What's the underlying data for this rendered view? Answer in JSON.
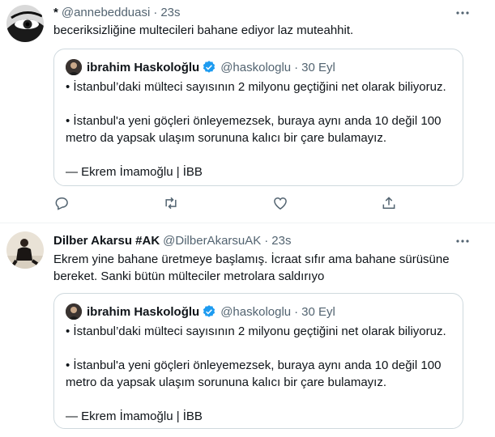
{
  "tweets": [
    {
      "name": "*",
      "handle": "@annebedduasi",
      "dot": "·",
      "time": "23s",
      "text": "beceriksizliğine multecileri bahane ediyor laz muteahhit.",
      "avatar_icon": "eye-avatar-icon",
      "quote": {
        "name": "ibrahim Haskoloğlu",
        "handle": "@haskologlu",
        "dot": "·",
        "time": "30 Eyl",
        "line1": "• İstanbul’daki mülteci sayısının 2 milyonu geçtiğini net olarak biliyoruz.",
        "line2": "• İstanbul'a yeni göçleri önleyemezsek, buraya aynı anda 10 değil 100 metro da yapsak ulaşım sorununa kalıcı bir çare bulamayız.",
        "line3": "— Ekrem İmamoğlu | İBB"
      }
    },
    {
      "name": "Dilber Akarsu #AK",
      "handle": "@DilberAkarsuAK",
      "dot": "·",
      "time": "23s",
      "text": "Ekrem yine bahane üretmeye başlamış. İcraat sıfır ama bahane sürüsüne bereket. Sanki bütün mülteciler metrolara saldırıyo",
      "avatar_icon": "person-avatar-icon",
      "quote": {
        "name": "ibrahim Haskoloğlu",
        "handle": "@haskologlu",
        "dot": "·",
        "time": "30 Eyl",
        "line1": "• İstanbul’daki mülteci sayısının 2 milyonu geçtiğini net olarak biliyoruz.",
        "line2": "• İstanbul'a yeni göçleri önleyemezsek, buraya aynı anda 10 değil 100 metro da yapsak ulaşım sorununa kalıcı bir çare bulamayız.",
        "line3": "— Ekrem İmamoğlu | İBB"
      }
    }
  ],
  "colors": {
    "text": "#0f1419",
    "muted": "#536471",
    "border": "#cfd9de",
    "verified": "#1d9bf0"
  },
  "icons": [
    "more-icon",
    "reply-icon",
    "retweet-icon",
    "like-icon",
    "share-icon",
    "verified-badge-icon"
  ]
}
